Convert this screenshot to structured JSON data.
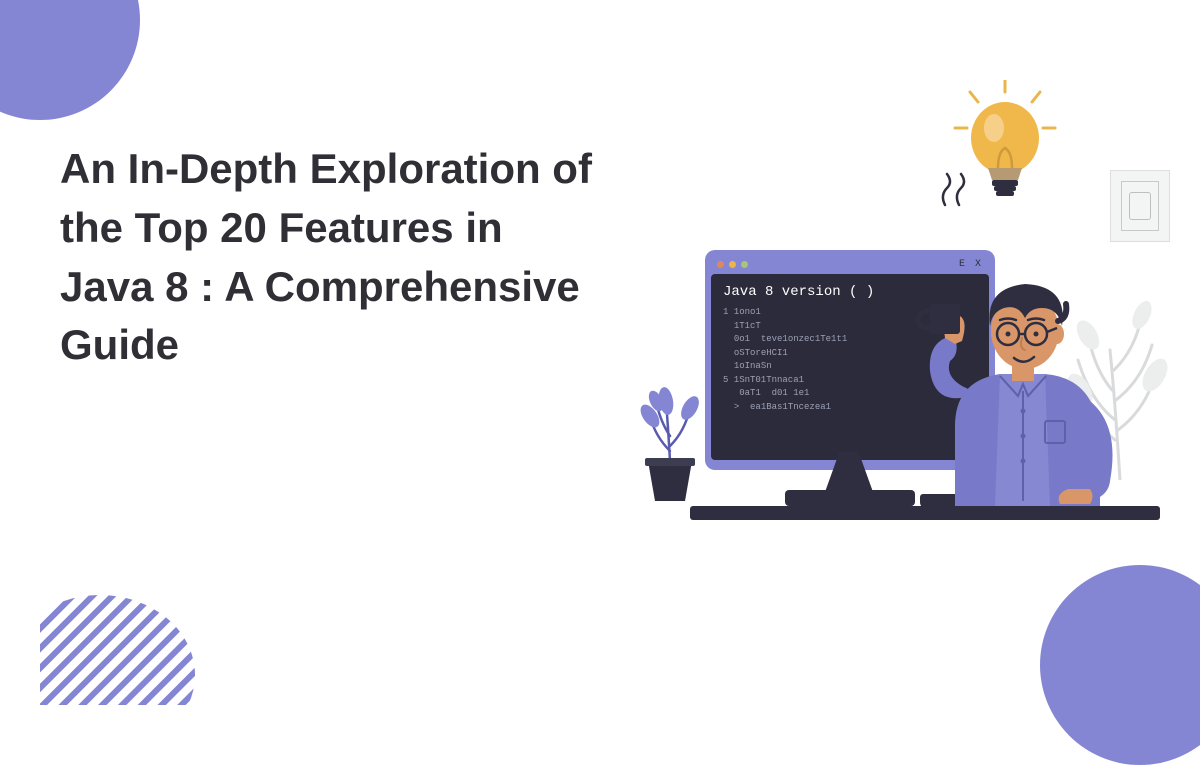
{
  "headline": "An In-Depth Exploration of the Top 20 Features in Java 8 : A Comprehensive Guide",
  "monitor": {
    "title": "Java 8 version ( )",
    "topbar_right": "E X",
    "code": "1 1ono1\n  1T1cT\n  0o1  teve1onzec1Te1t1\n  oSToreHCI1\n  1oInaSn\n5 1SnT01Tnnaca1\n   0aT1  d01 1e1\n  >  ea1Bas1Tncezea1"
  },
  "colors": {
    "accent": "#8486d4",
    "bulb": "#f0b84b",
    "skin": "#d99668",
    "shirt": "#7879c8",
    "hair": "#2e2e40"
  }
}
